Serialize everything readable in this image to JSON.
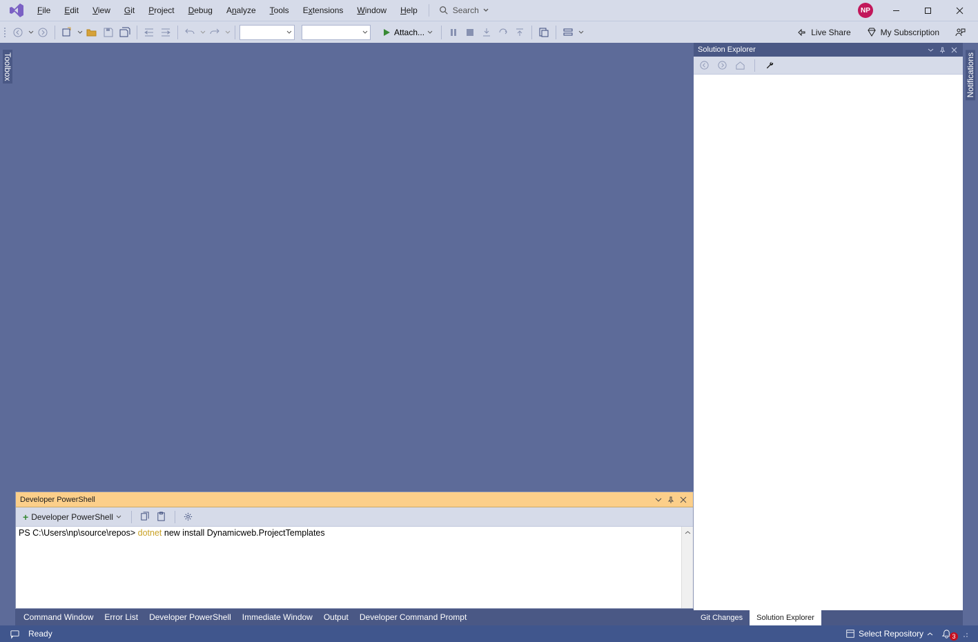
{
  "menu": {
    "items": [
      "File",
      "Edit",
      "View",
      "Git",
      "Project",
      "Debug",
      "Analyze",
      "Tools",
      "Extensions",
      "Window",
      "Help"
    ]
  },
  "search": {
    "label": "Search",
    "caret": "▾"
  },
  "avatar": {
    "initials": "NP"
  },
  "toolbar": {
    "attach_label": "Attach...",
    "live_share": "Live Share",
    "my_subscription": "My Subscription"
  },
  "left_side_tab": "Toolbox",
  "right_side_tab": "Notifications",
  "solution_explorer": {
    "title": "Solution Explorer",
    "tabs": {
      "git_changes": "Git Changes",
      "active": "Solution Explorer"
    }
  },
  "ps_panel": {
    "title": "Developer PowerShell",
    "tab_label": "Developer PowerShell",
    "prompt_prefix": "PS C:\\Users\\np\\source\\repos> ",
    "cmd_keyword": "dotnet",
    "cmd_rest": " new install Dynamicweb.ProjectTemplates"
  },
  "bottom_tabs": [
    "Command Window",
    "Error List",
    "Developer PowerShell",
    "Immediate Window",
    "Output",
    "Developer Command Prompt"
  ],
  "statusbar": {
    "ready": "Ready",
    "select_repo": "Select Repository",
    "notif_count": "3"
  }
}
